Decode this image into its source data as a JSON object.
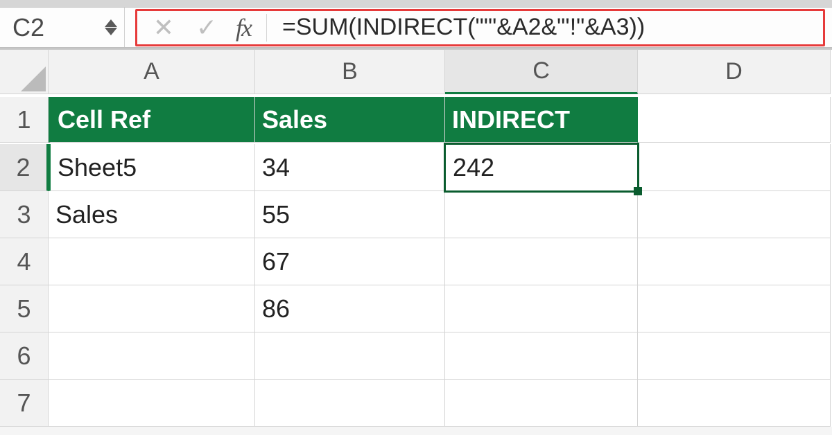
{
  "name_box": "C2",
  "formula_bar": {
    "fx_label": "fx",
    "formula": "=SUM(INDIRECT(\"'\"&A2&\"'!\"&A3))"
  },
  "columns": [
    "A",
    "B",
    "C",
    "D"
  ],
  "rows": [
    "1",
    "2",
    "3",
    "4",
    "5",
    "6",
    "7"
  ],
  "headers_row1": {
    "A": "Cell Ref",
    "B": "Sales",
    "C": "INDIRECT"
  },
  "data": {
    "A2": "Sheet5",
    "B2": "34",
    "C2": "242",
    "A3": "Sales",
    "B3": "55",
    "B4": "67",
    "B5": "86"
  },
  "active_cell": "C2",
  "icons": {
    "cancel": "✕",
    "enter": "✓"
  }
}
